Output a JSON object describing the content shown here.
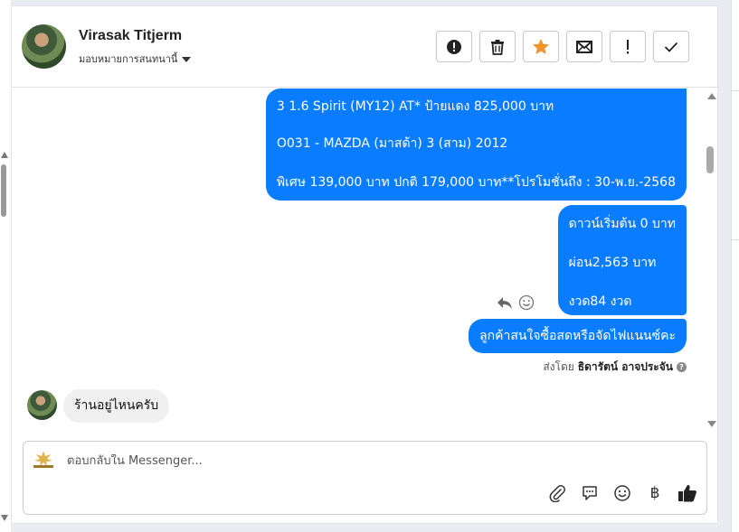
{
  "header": {
    "contact_name": "Virasak Titjerm",
    "assign_label": "มอบหมายการสนทนานี้",
    "actions": [
      {
        "name": "spam-button",
        "icon": "alert-circle-icon"
      },
      {
        "name": "delete-button",
        "icon": "trash-icon"
      },
      {
        "name": "star-button",
        "icon": "star-icon",
        "color": "#f0932b"
      },
      {
        "name": "email-button",
        "icon": "envelope-icon"
      },
      {
        "name": "follow-up-button",
        "icon": "exclamation-icon"
      },
      {
        "name": "done-button",
        "icon": "check-icon"
      }
    ]
  },
  "messages": {
    "outgoing_1": {
      "line1": "3 1.6 Spirit (MY12) AT* ป้ายแดง 825,000 บาท",
      "line2": "O031 - MAZDA (มาสด้า) 3 (สาม) 2012",
      "line3": "พิเศษ 139,000 บาท  ปกติ 179,000 บาท**โปรโมชั่นถึง : 30-พ.ย.-2568"
    },
    "outgoing_2": {
      "line1": "ดาวน์เริ่มต้น 0 บาท",
      "line2": "ผ่อน2,563 บาท",
      "line3": "งวด84 งวด"
    },
    "outgoing_3": "ลูกค้าสนใจซื้อสดหรือจัดไฟแนนซ์คะ",
    "sent_by_label": "ส่งโดย",
    "sent_by_name": "ธิดารัตน์ อาจประจัน",
    "incoming_1": "ร้านอยู่ไหนครับ"
  },
  "composer": {
    "placeholder": "ตอบกลับใน Messenger...",
    "tools": [
      "paperclip-icon",
      "chat-bubble-icon",
      "emoji-icon",
      "baht-icon",
      "thumbs-up-icon"
    ],
    "baht_symbol": "฿"
  },
  "colors": {
    "outgoing_bubble": "#0a7cff",
    "incoming_bubble": "#f0f0f0",
    "star": "#f0932b"
  }
}
